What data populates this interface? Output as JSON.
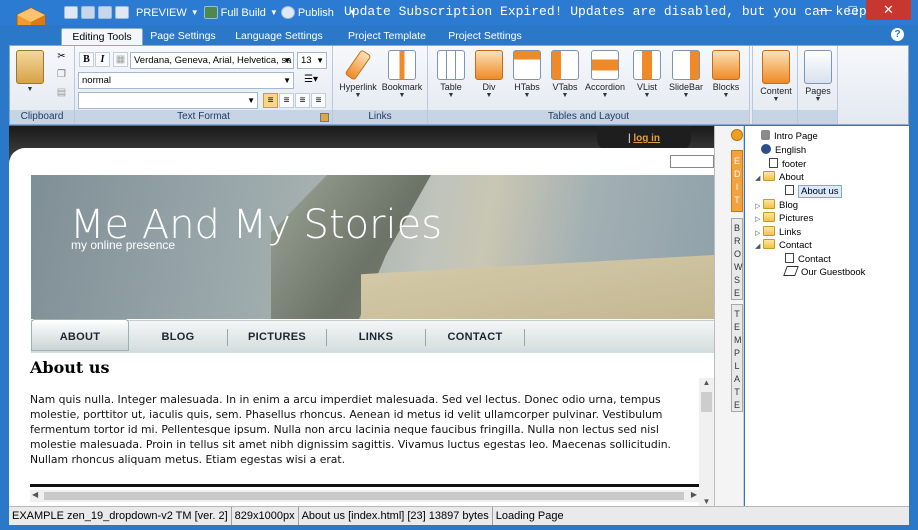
{
  "titlebar": {
    "preview": "PREVIEW",
    "full_build": "Full Build",
    "publish": "Publish",
    "title": "Update Subscription Expired! Updates are disabled, but you can keep...",
    "minimize": "—",
    "maximize": "□",
    "close": "✕"
  },
  "tabs": [
    {
      "label": "Editing Tools",
      "active": true
    },
    {
      "label": "Page Settings"
    },
    {
      "label": "Language Settings"
    },
    {
      "label": "Project Template"
    },
    {
      "label": "Project Settings"
    }
  ],
  "ribbon": {
    "clipboard_label": "Clipboard",
    "text_format_label": "Text Format",
    "links_label": "Links",
    "tables_label": "Tables and Layout",
    "font_family": "Verdana, Geneva, Arial, Helvetica, sa",
    "font_size": "13",
    "paragraph_style": "normal",
    "class_value": "",
    "bold": "B",
    "italic": "I",
    "buttons": {
      "hyperlink": "Hyperlink",
      "bookmark": "Bookmark",
      "table": "Table",
      "div": "Div",
      "htabs": "HTabs",
      "vtabs": "VTabs",
      "accordion": "Accordion",
      "vlist": "VList",
      "slidebar": "SlideBar",
      "blocks": "Blocks",
      "content": "Content",
      "pages": "Pages"
    }
  },
  "page": {
    "login_sep": "|",
    "login": "log in",
    "site_title": "Me And My Stories",
    "site_subtitle": "my online presence",
    "nav": [
      "ABOUT",
      "BLOG",
      "PICTURES",
      "LINKS",
      "CONTACT"
    ],
    "heading": "About us",
    "body": "Nam quis nulla. Integer malesuada. In in enim a arcu imperdiet malesuada. Sed vel lectus. Donec odio urna, tempus molestie, porttitor ut, iaculis quis, sem. Phasellus rhoncus. Aenean id metus id velit ullamcorper pulvinar. Vestibulum fermentum tortor id mi. Pellentesque ipsum. Nulla non arcu lacinia neque faucibus fringilla. Nulla non lectus sed nisl molestie malesuada. Proin in tellus sit amet nibh dignissim sagittis. Vivamus luctus egestas leo. Maecenas sollicitudin. Nullam rhoncus aliquam metus. Etiam egestas wisi a erat."
  },
  "side_tabs": {
    "edit": "EDIT",
    "browse": "BROWSE",
    "template": "TEMPLATE"
  },
  "tree": {
    "intro": "Intro Page",
    "english": "English",
    "footer": "footer",
    "about": "About",
    "about_us": "About us",
    "blog": "Blog",
    "pictures": "Pictures",
    "links": "Links",
    "contact": "Contact",
    "contact_page": "Contact",
    "guestbook": "Our Guestbook"
  },
  "status": {
    "project": "EXAMPLE zen_19_dropdown-v2 TM [ver. 2]",
    "size": "829x1000px",
    "page": "About us [index.html] [23] 13897 bytes",
    "state": "Loading Page"
  }
}
